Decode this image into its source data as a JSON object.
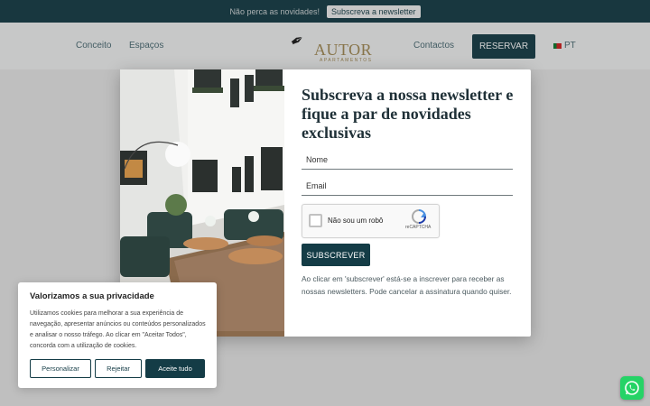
{
  "topbar": {
    "text": "Não perca as novidades!",
    "button": "Subscreva a newsletter"
  },
  "nav": {
    "links": [
      "Conceito",
      "Espaços"
    ],
    "right_link": "Contactos",
    "reserve": "RESERVAR",
    "lang": "PT",
    "logo": {
      "word": "AUTOR",
      "sub": "APARTAMENTOS"
    }
  },
  "modal": {
    "title": "Subscreva a nossa newsletter e fique a par de novidades exclusivas",
    "name_placeholder": "Nome",
    "email_placeholder": "Email",
    "captcha_label": "Não sou um robô",
    "captcha_brand": "reCAPTCHA",
    "subscribe": "SUBSCREVER",
    "disclaimer": "Ao clicar em 'subscrever' está-se a inscrever para receber as nossas newsletters. Pode cancelar a assinatura quando quiser.",
    "close": "×"
  },
  "cookie": {
    "title": "Valorizamos a sua privacidade",
    "body": "Utilizamos cookies para melhorar a sua experiência de navegação, apresentar anúncios ou conteúdos personalizados e analisar o nosso tráfego. Ao clicar em \"Aceitar Todos\", concorda com a utilização de cookies.",
    "customize": "Personalizar",
    "reject": "Rejeitar",
    "accept": "Aceite tudo"
  },
  "colors": {
    "brand": "#143c46",
    "gold": "#a28a54",
    "whatsapp": "#25d366"
  },
  "icons": {
    "close": "close-icon",
    "whatsapp": "whatsapp-icon",
    "flag": "portugal-flag-icon",
    "recaptcha": "recaptcha-icon"
  }
}
